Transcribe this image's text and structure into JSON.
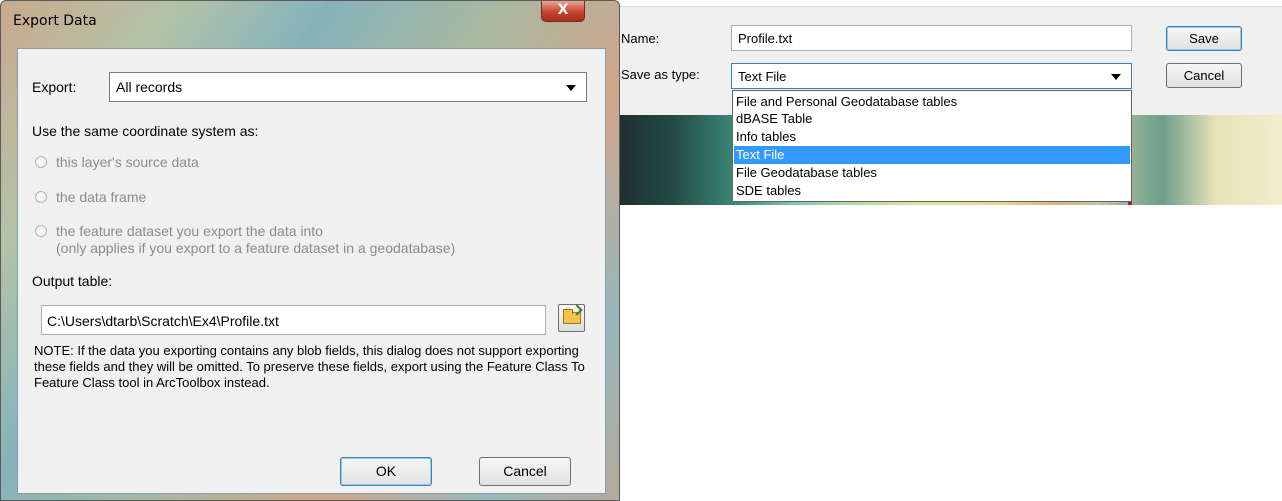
{
  "export_dialog": {
    "title": "Export Data",
    "close_label": "X",
    "export_label": "Export:",
    "export_value": "All records",
    "coord_heading": "Use the same coordinate system as:",
    "radio_options": [
      "this layer's source data",
      "the data frame",
      "the feature dataset you export the data into",
      "(only applies if you export to a feature dataset in a geodatabase)"
    ],
    "output_label": "Output table:",
    "output_value": "C:\\Users\\dtarb\\Scratch\\Ex4\\Profile.txt",
    "note": "NOTE: If the data you exporting contains any blob fields, this dialog does not support exporting these fields and they will be omitted. To preserve these fields, export using the Feature Class To Feature Class tool in ArcToolbox instead.",
    "ok_label": "OK",
    "cancel_label": "Cancel"
  },
  "save_dialog": {
    "name_label": "Name:",
    "name_value": "Profile.txt",
    "type_label": "Save as type:",
    "type_value": "Text File",
    "save_label": "Save",
    "cancel_label": "Cancel",
    "type_options": [
      "File and Personal Geodatabase tables",
      "dBASE Table",
      "Info tables",
      "Text File",
      "File Geodatabase tables",
      "SDE tables"
    ],
    "selected_option_index": 3
  },
  "colors": {
    "selection": "#3399ff",
    "close_button": "#c4432c",
    "default_button_border": "#3c7fb1"
  }
}
